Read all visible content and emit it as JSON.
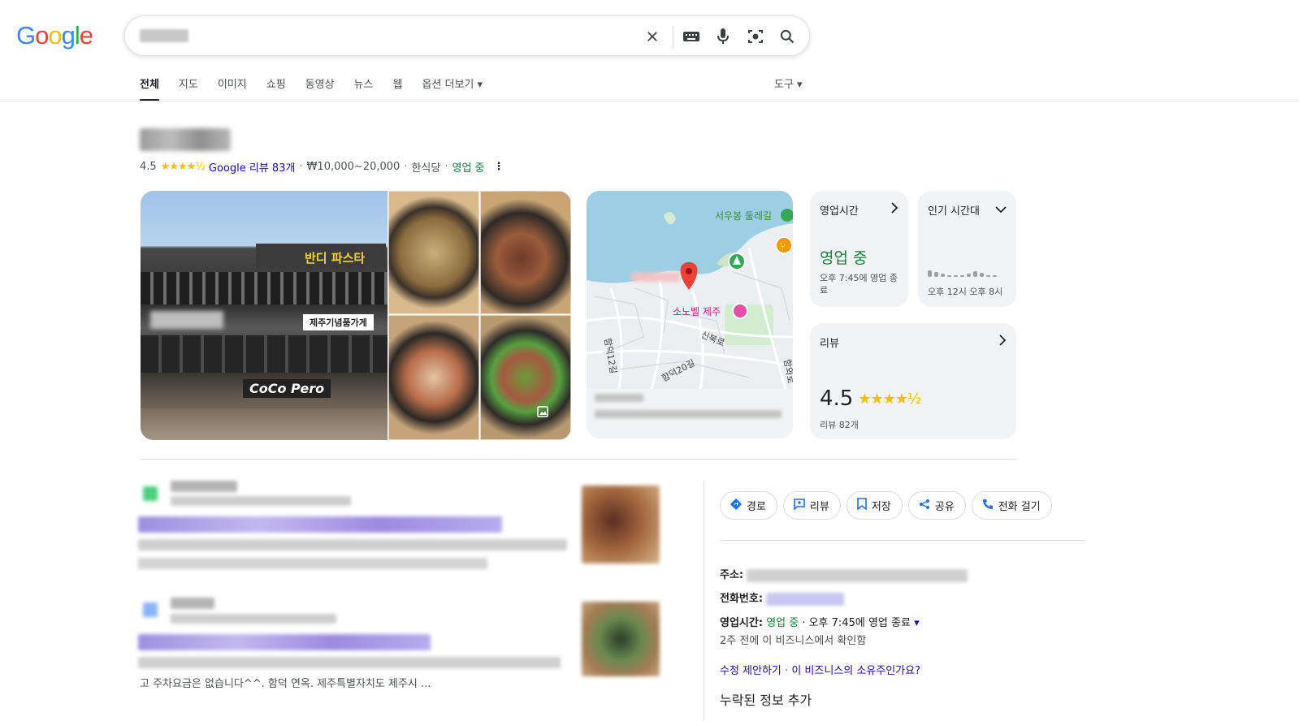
{
  "logo": {
    "letters": [
      "G",
      "o",
      "o",
      "g",
      "l",
      "e"
    ],
    "colors": [
      "#4285F4",
      "#EA4335",
      "#FBBC05",
      "#4285F4",
      "#34A853",
      "#EA4335"
    ]
  },
  "search": {
    "value": "",
    "placeholder": ""
  },
  "tabs": [
    {
      "label": "전체",
      "active": true
    },
    {
      "label": "지도"
    },
    {
      "label": "이미지"
    },
    {
      "label": "쇼핑"
    },
    {
      "label": "동영상"
    },
    {
      "label": "뉴스"
    },
    {
      "label": "웹"
    },
    {
      "label": "옵션 더보기 ▾"
    }
  ],
  "tools_label": "도구 ▾",
  "business": {
    "rating": "4.5",
    "stars": "★★★★½",
    "reviews_link": "Google 리뷰 83개",
    "price": "₩10,000~20,000",
    "category": "한식당",
    "status": "영업 중",
    "more": "⋮"
  },
  "photos": {
    "sign_main": "반디 파스타",
    "sign_souvenir": "제주기념품가게",
    "sign_cafe": "CoCo Pero"
  },
  "map": {
    "label_trail": "서우봉 둘레길",
    "label_place": "소노벨 제주",
    "road_1": "신북로",
    "road_2": "함덕12길",
    "road_3": "함덕20길",
    "road_4": "함와로"
  },
  "cards": {
    "hours_title": "영업시간",
    "hours_status": "영업 중",
    "hours_sub": "오후 7:45에 영업 종료",
    "popular_title": "인기 시간대",
    "popular_times": "오후 12시   오후 8시",
    "popular_levels": [
      0.6,
      0.45,
      0.25,
      0.12,
      0.12,
      0.1,
      0.3,
      0.5,
      0.35,
      0.12,
      0.1
    ],
    "reviews_title": "리뷰",
    "reviews_rating": "4.5",
    "reviews_stars": "★★★★½",
    "reviews_count": "리뷰 82개"
  },
  "results": {
    "snippet_tail": "고 주차요금은 없습니다^^. 함덕 연옥. 제주특별자치도 제주시 ..."
  },
  "actions": [
    {
      "icon": "◆",
      "label": "경로",
      "name": "directions-button"
    },
    {
      "icon": "✎",
      "label": "리뷰",
      "name": "review-button"
    },
    {
      "icon": "🔖",
      "label": "저장",
      "name": "save-button"
    },
    {
      "icon": "⤴",
      "label": "공유",
      "name": "share-button"
    },
    {
      "icon": "✆",
      "label": "전화 걸기",
      "name": "call-button"
    }
  ],
  "info": {
    "address_label": "주소:",
    "phone_label": "전화번호:",
    "hours_label": "영업시간:",
    "hours_status": "영업 중",
    "hours_rest": " · 오후 7:45에 영업 종료",
    "hours_caret": "▾",
    "confirmed": "2주 전에 이 비즈니스에서 확인함",
    "suggest_edit": "수정 제안하기",
    "owner_link": "이 비즈니스의 소유주인가요?",
    "missing": "누락된 정보 추가"
  }
}
